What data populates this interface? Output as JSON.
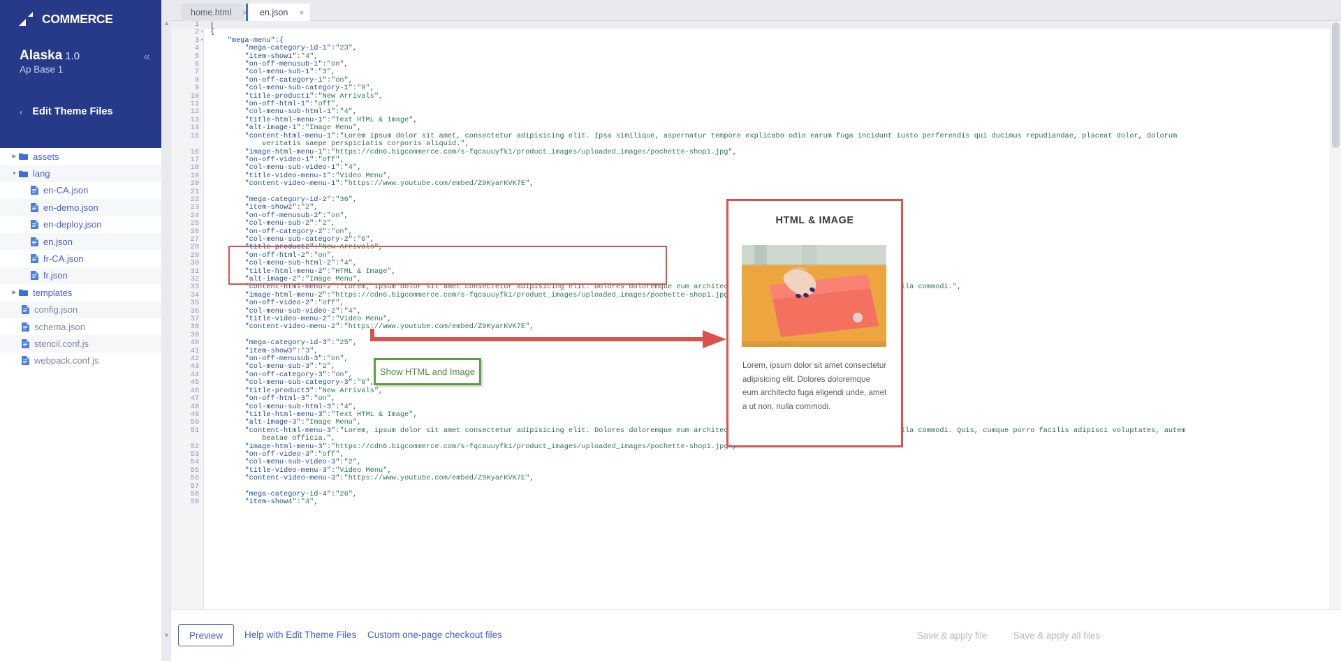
{
  "brand": {
    "logo_text": "COMMERCE",
    "logo_mark": "bigcommerce-logo-icon",
    "primary_color": "#273a8a",
    "link_color": "#4a5ecb"
  },
  "sidebar": {
    "theme_name": "Alaska",
    "theme_version": "1.0",
    "theme_variant": "Ap Base 1",
    "collapse_label": "«",
    "back_chevron": "‹",
    "section_label": "Edit Theme Files",
    "tree": [
      {
        "label": "assets",
        "type": "folder",
        "state": "collapsed",
        "depth": 0
      },
      {
        "label": "lang",
        "type": "folder",
        "state": "expanded",
        "depth": 0
      },
      {
        "label": "en-CA.json",
        "type": "file",
        "state": "",
        "depth": 1
      },
      {
        "label": "en-demo.json",
        "type": "file",
        "state": "",
        "depth": 1
      },
      {
        "label": "en-deploy.json",
        "type": "file",
        "state": "",
        "depth": 1
      },
      {
        "label": "en.json",
        "type": "file",
        "state": "",
        "depth": 1
      },
      {
        "label": "fr-CA.json",
        "type": "file",
        "state": "",
        "depth": 1
      },
      {
        "label": "fr.json",
        "type": "file",
        "state": "",
        "depth": 1
      },
      {
        "label": "templates",
        "type": "folder",
        "state": "collapsed",
        "depth": 0
      },
      {
        "label": "config.json",
        "type": "file",
        "state": "",
        "depth": 0,
        "muted": true
      },
      {
        "label": "schema.json",
        "type": "file",
        "state": "",
        "depth": 0,
        "muted": true
      },
      {
        "label": "stencil.conf.js",
        "type": "file",
        "state": "",
        "depth": 0,
        "muted": true
      },
      {
        "label": "webpack.conf.js",
        "type": "file",
        "state": "",
        "depth": 0,
        "muted": true
      }
    ]
  },
  "editor": {
    "tabs": [
      {
        "label": "home.html",
        "active": false,
        "close": "×"
      },
      {
        "label": "en.json",
        "active": true,
        "close": "×"
      }
    ],
    "lines": [
      {
        "n": 1,
        "fold": "",
        "text": ""
      },
      {
        "n": 2,
        "fold": "▾",
        "text": "{"
      },
      {
        "n": 3,
        "fold": "▾",
        "text": "    \"mega-menu\":{"
      },
      {
        "n": 4,
        "fold": "",
        "text": "        \"mega-category-id-1\":\"23\","
      },
      {
        "n": 5,
        "fold": "",
        "text": "        \"item-show1\":\"4\","
      },
      {
        "n": 6,
        "fold": "",
        "text": "        \"on-off-menusub-1\":\"on\","
      },
      {
        "n": 7,
        "fold": "",
        "text": "        \"col-menu-sub-1\":\"3\","
      },
      {
        "n": 8,
        "fold": "",
        "text": "        \"on-off-category-1\":\"on\","
      },
      {
        "n": 9,
        "fold": "",
        "text": "        \"col-menu-sub-category-1\":\"9\","
      },
      {
        "n": 10,
        "fold": "",
        "text": "        \"title-product1\":\"New Arrivals\","
      },
      {
        "n": 11,
        "fold": "",
        "text": "        \"on-off-html-1\":\"off\","
      },
      {
        "n": 12,
        "fold": "",
        "text": "        \"col-menu-sub-html-1\":\"4\","
      },
      {
        "n": 13,
        "fold": "",
        "text": "        \"title-html-menu-1\":\"Text HTML & Image\","
      },
      {
        "n": 14,
        "fold": "",
        "text": "        \"alt-image-1\":\"Image Menu\","
      },
      {
        "n": 15,
        "fold": "",
        "text": "        \"content-html-menu-1\":\"Lorem ipsum dolor sit amet, consectetur adipisicing elit. Ipsa similique, aspernatur tempore explicabo odio earum fuga incidunt iusto perferendis qui ducimus repudiandae, placeat dolor, dolorum"
      },
      {
        "n": "",
        "fold": "",
        "text": "            veritatis saepe perspiciatis corporis aliquid.\","
      },
      {
        "n": 16,
        "fold": "",
        "text": "        \"image-html-menu-1\":\"https://cdn6.bigcommerce.com/s-fqcauuyfk1/product_images/uploaded_images/pochette-shop1.jpg\","
      },
      {
        "n": 17,
        "fold": "",
        "text": "        \"on-off-video-1\":\"off\","
      },
      {
        "n": 18,
        "fold": "",
        "text": "        \"col-menu-sub-video-1\":\"4\","
      },
      {
        "n": 19,
        "fold": "",
        "text": "        \"title-video-menu-1\":\"Video Menu\","
      },
      {
        "n": 20,
        "fold": "",
        "text": "        \"content-video-menu-1\":\"https://www.youtube.com/embed/Z9KyarKVK7E\","
      },
      {
        "n": 21,
        "fold": "",
        "text": ""
      },
      {
        "n": 22,
        "fold": "",
        "text": "        \"mega-category-id-2\":\"36\","
      },
      {
        "n": 23,
        "fold": "",
        "text": "        \"item-show2\":\"2\","
      },
      {
        "n": 24,
        "fold": "",
        "text": "        \"on-off-menusub-2\":\"on\","
      },
      {
        "n": 25,
        "fold": "",
        "text": "        \"col-menu-sub-2\":\"2\","
      },
      {
        "n": 26,
        "fold": "",
        "text": "        \"on-off-category-2\":\"on\","
      },
      {
        "n": 27,
        "fold": "",
        "text": "        \"col-menu-sub-category-2\":\"6\","
      },
      {
        "n": 28,
        "fold": "",
        "text": "        \"title-product2\":\"New Arrivals\","
      },
      {
        "n": 29,
        "fold": "",
        "text": "        \"on-off-html-2\":\"on\","
      },
      {
        "n": 30,
        "fold": "",
        "text": "        \"col-menu-sub-html-2\":\"4\","
      },
      {
        "n": 31,
        "fold": "",
        "text": "        \"title-html-menu-2\":\"HTML & Image\","
      },
      {
        "n": 32,
        "fold": "",
        "text": "        \"alt-image-2\":\"Image Menu\","
      },
      {
        "n": 33,
        "fold": "",
        "text": "        \"content-html-menu-2\":\"Lorem, ipsum dolor sit amet consectetur adipisicing elit. Dolores doloremque eum architecto fuga eligendi unde, amet a ut non, nulla commodi.\","
      },
      {
        "n": 34,
        "fold": "",
        "text": "        \"image-html-menu-2\":\"https://cdn6.bigcommerce.com/s-fqcauuyfk1/product_images/uploaded_images/pochette-shop1.jpg\","
      },
      {
        "n": 35,
        "fold": "",
        "text": "        \"on-off-video-2\":\"off\","
      },
      {
        "n": 36,
        "fold": "",
        "text": "        \"col-menu-sub-video-2\":\"4\","
      },
      {
        "n": 37,
        "fold": "",
        "text": "        \"title-video-menu-2\":\"Video Menu\","
      },
      {
        "n": 38,
        "fold": "",
        "text": "        \"content-video-menu-2\":\"https://www.youtube.com/embed/Z9KyarKVK7E\","
      },
      {
        "n": 39,
        "fold": "",
        "text": ""
      },
      {
        "n": 40,
        "fold": "",
        "text": "        \"mega-category-id-3\":\"25\","
      },
      {
        "n": 41,
        "fold": "",
        "text": "        \"item-show3\":\"3\","
      },
      {
        "n": 42,
        "fold": "",
        "text": "        \"on-off-menusub-3\":\"on\","
      },
      {
        "n": 43,
        "fold": "",
        "text": "        \"col-menu-sub-3\":\"2\","
      },
      {
        "n": 44,
        "fold": "",
        "text": "        \"on-off-category-3\":\"on\","
      },
      {
        "n": 45,
        "fold": "",
        "text": "        \"col-menu-sub-category-3\":\"6\","
      },
      {
        "n": 46,
        "fold": "",
        "text": "        \"title-product3\":\"New Arrivals\","
      },
      {
        "n": 47,
        "fold": "",
        "text": "        \"on-off-html-3\":\"on\","
      },
      {
        "n": 48,
        "fold": "",
        "text": "        \"col-menu-sub-html-3\":\"4\","
      },
      {
        "n": 49,
        "fold": "",
        "text": "        \"title-html-menu-3\":\"Text HTML & Image\","
      },
      {
        "n": 50,
        "fold": "",
        "text": "        \"alt-image-3\":\"Image Menu\","
      },
      {
        "n": 51,
        "fold": "",
        "text": "        \"content-html-menu-3\":\"Lorem, ipsum dolor sit amet consectetur adipisicing elit. Dolores doloremque eum architecto fuga eligendi unde, amet a ut non, nulla commodi. Quis, cumque porro facilis adipisci voluptates, autem"
      },
      {
        "n": "",
        "fold": "",
        "text": "            beatae officia.\","
      },
      {
        "n": 52,
        "fold": "",
        "text": "        \"image-html-menu-3\":\"https://cdn6.bigcommerce.com/s-fqcauuyfk1/product_images/uploaded_images/pochette-shop1.jpg\","
      },
      {
        "n": 53,
        "fold": "",
        "text": "        \"on-off-video-3\":\"off\","
      },
      {
        "n": 54,
        "fold": "",
        "text": "        \"col-menu-sub-video-3\":\"2\","
      },
      {
        "n": 55,
        "fold": "",
        "text": "        \"title-video-menu-3\":\"Video Menu\","
      },
      {
        "n": 56,
        "fold": "",
        "text": "        \"content-video-menu-3\":\"https://www.youtube.com/embed/Z9KyarKVK7E\","
      },
      {
        "n": 57,
        "fold": "",
        "text": ""
      },
      {
        "n": 58,
        "fold": "",
        "text": "        \"mega-category-id-4\":\"26\","
      },
      {
        "n": 59,
        "fold": "",
        "text": "        \"item-show4\":\"4\","
      }
    ]
  },
  "annotations": {
    "green_callout": "Show HTML and Image",
    "highlight_color": "#d9534f",
    "callout_color": "#5aa042"
  },
  "preview": {
    "title": "HTML & IMAGE",
    "image_alt": "Image Menu",
    "body": "Lorem, ipsum dolor sit amet consectetur adipisicing elit. Dolores doloremque eum architecto fuga eligendi unde, amet a ut non, nulla commodi."
  },
  "bottom_bar": {
    "preview_button": "Preview",
    "help_link": "Help with Edit Theme Files",
    "checkout_link": "Custom one-page checkout files",
    "save_file_button": "Save & apply file",
    "save_all_button": "Save & apply all files"
  }
}
